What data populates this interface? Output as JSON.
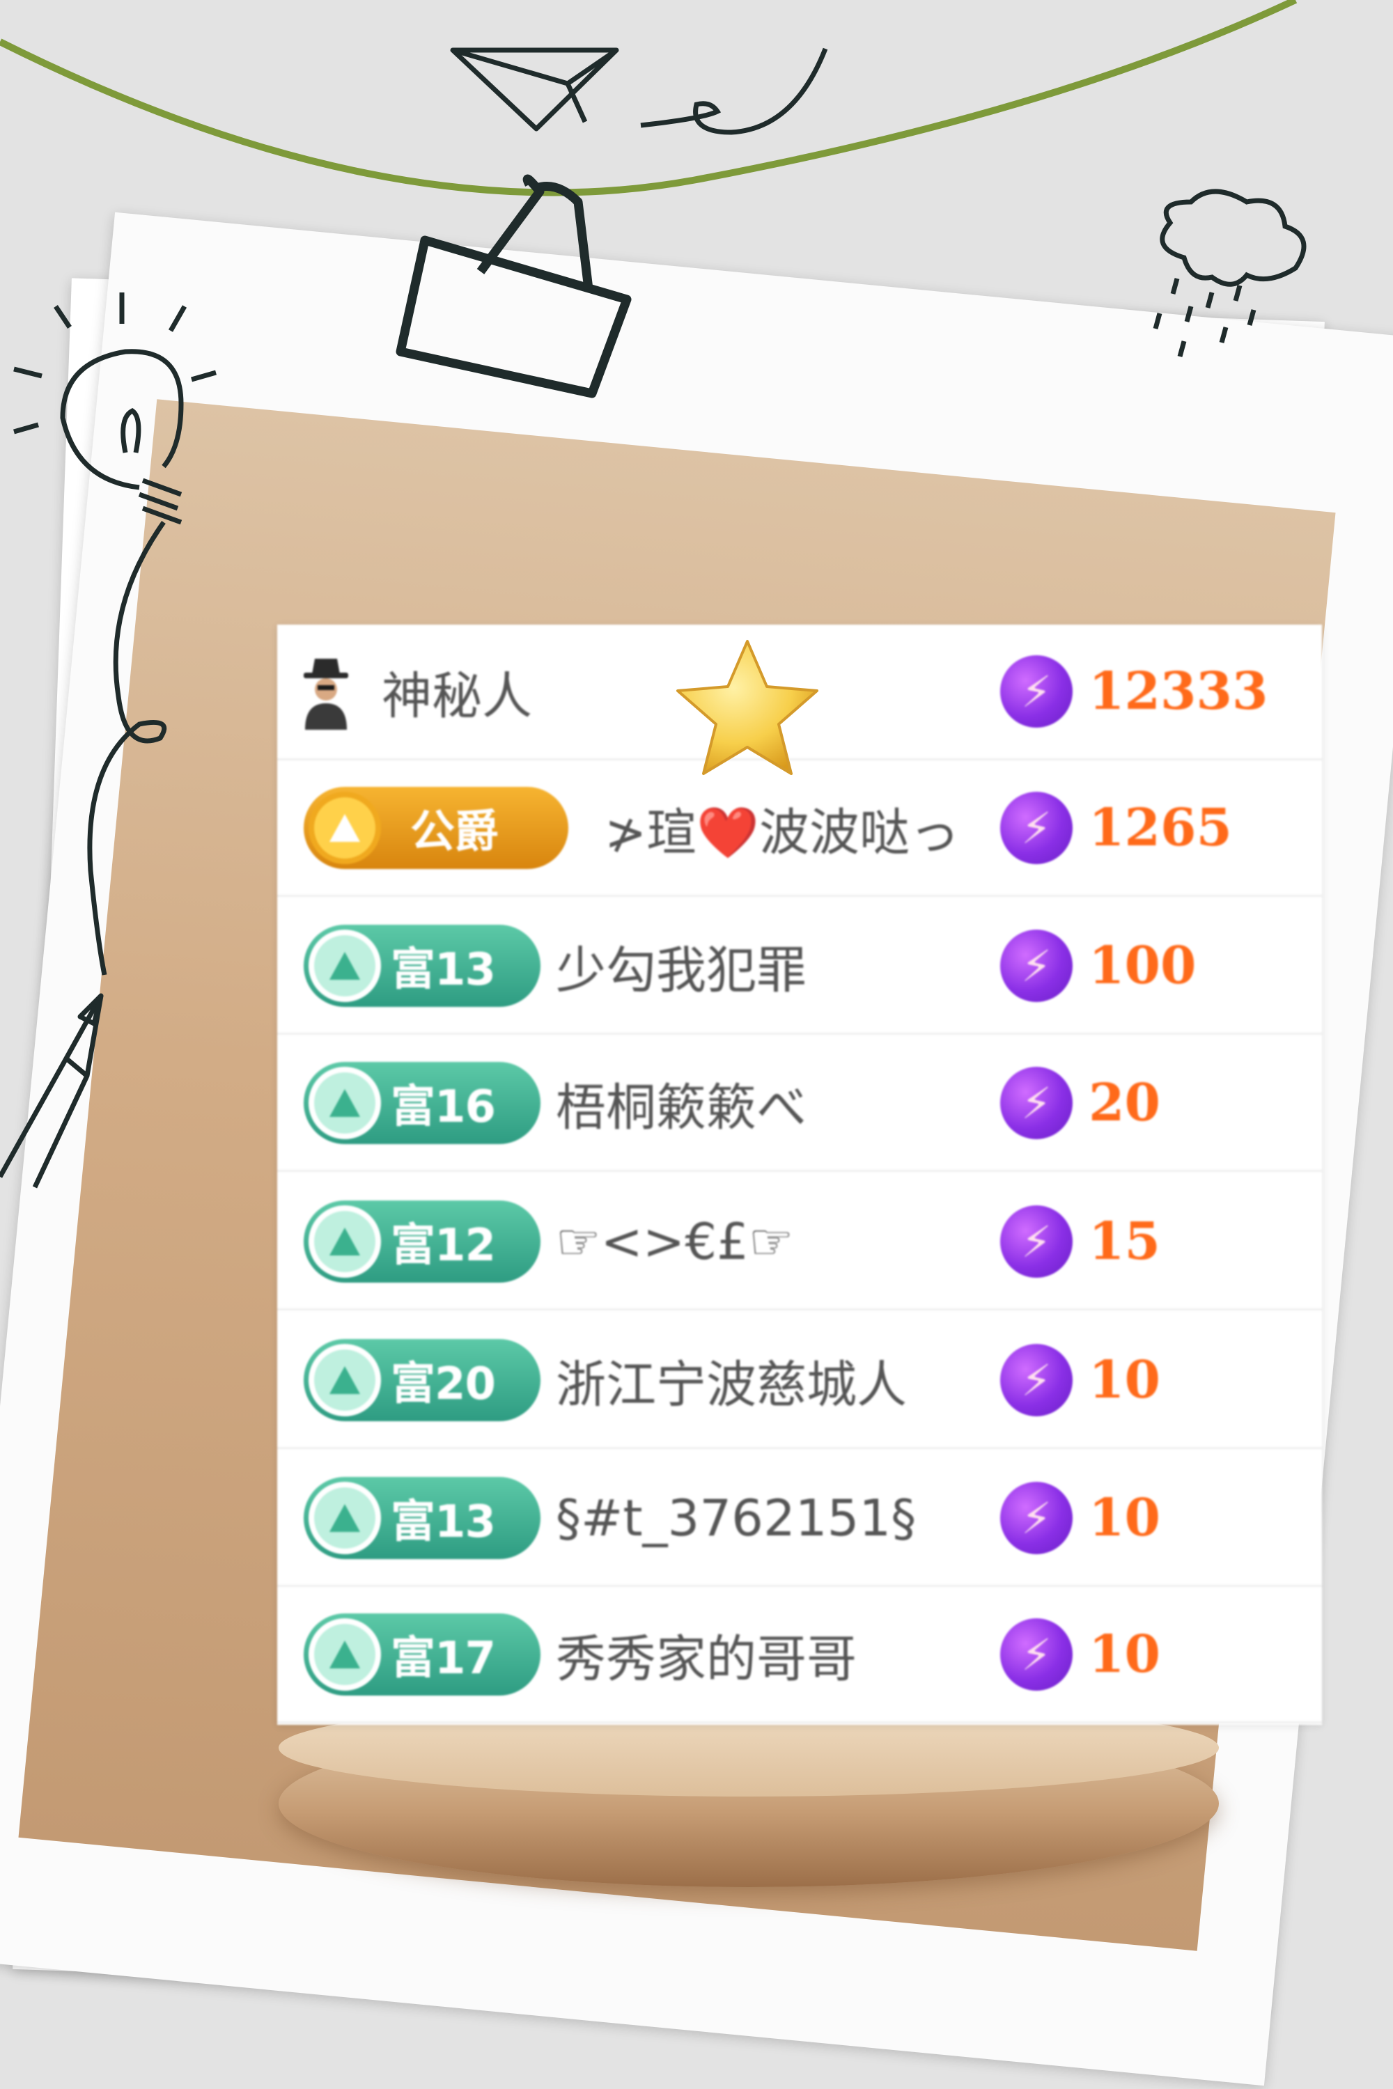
{
  "colors": {
    "background": "#e3e3e3",
    "score": "#ff6a1a",
    "badge_green": "#2e9c82",
    "badge_gold": "#e59a16",
    "vine": "#7e9a3a"
  },
  "leaderboard": {
    "rows": [
      {
        "badge_type": "avatar",
        "badge_label": "",
        "name": "神秘人",
        "score": "12333"
      },
      {
        "badge_type": "gold",
        "badge_label": "公爵",
        "name": "≯瑄❤️波波哒っ",
        "score": "1265"
      },
      {
        "badge_type": "green",
        "badge_label": "富13",
        "name": "少勾我犯罪",
        "score": "100"
      },
      {
        "badge_type": "green",
        "badge_label": "富16",
        "name": "梧桐簌簌べ",
        "score": "20"
      },
      {
        "badge_type": "green",
        "badge_label": "富12",
        "name": "☞<>€£☞",
        "score": "15"
      },
      {
        "badge_type": "green",
        "badge_label": "富20",
        "name": "浙江宁波慈城人",
        "score": "10"
      },
      {
        "badge_type": "green",
        "badge_label": "富13",
        "name": "§#t_3762151§",
        "score": "10"
      },
      {
        "badge_type": "green",
        "badge_label": "富17",
        "name": "秀秀家的哥哥",
        "score": "10"
      }
    ]
  },
  "icons": {
    "currency": "lightning-bolt-icon",
    "top_rank": "star-icon",
    "mystery_user": "spy-avatar-icon"
  }
}
